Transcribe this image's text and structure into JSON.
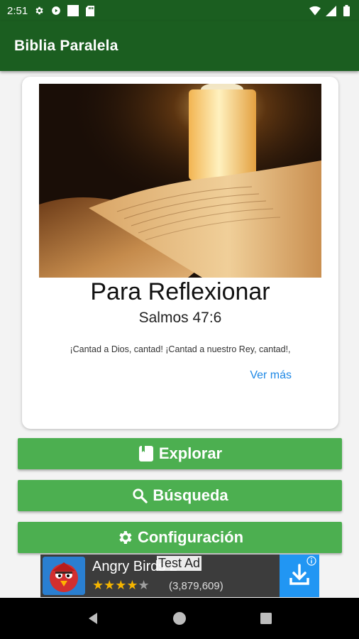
{
  "status_bar": {
    "time": "2:51",
    "icons": [
      "gear-icon",
      "play-protect-icon",
      "square-icon",
      "sd-card-icon",
      "wifi-icon",
      "signal-icon",
      "battery-icon"
    ]
  },
  "app_bar": {
    "title": "Biblia Paralela"
  },
  "devotional": {
    "heading": "Para Reflexionar",
    "reference": "Salmos 47:6",
    "verse": "¡Cantad a Dios, cantad! ¡Cantad a nuestro Rey, cantad!,",
    "more_label": "Ver más"
  },
  "buttons": {
    "explorar": "Explorar",
    "busqueda": "Búsqueda",
    "configuracion": "Configuración"
  },
  "ad": {
    "app_name": "Angry Birds 2",
    "test_label": "Test Ad",
    "rating_stars": "★★★★★",
    "rating_value": 4,
    "reviews": "(3,879,609)"
  },
  "colors": {
    "app_bar": "#1b5e20",
    "button": "#4caf50",
    "link": "#1e88e5"
  }
}
